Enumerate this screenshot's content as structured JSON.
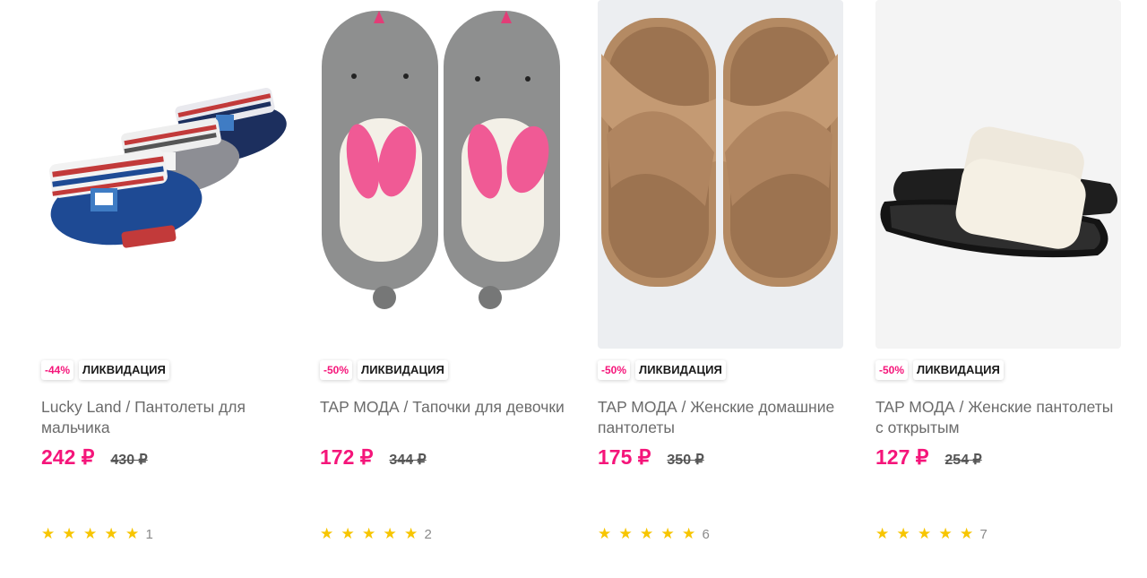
{
  "products": [
    {
      "discount": "-44%",
      "badge": "ЛИКВИДАЦИЯ",
      "title": "Lucky Land / Пантолеты для мальчика",
      "price": "242 ₽",
      "old_price": "430 ₽",
      "rating_stars": "★★★★★",
      "rating_value": 5,
      "reviews": "1"
    },
    {
      "discount": "-50%",
      "badge": "ЛИКВИДАЦИЯ",
      "title": "TAP МОДА / Тапочки для девочки",
      "price": "172 ₽",
      "old_price": "344 ₽",
      "rating_stars": "★★★★★",
      "rating_value": 5,
      "reviews": "2"
    },
    {
      "discount": "-50%",
      "badge": "ЛИКВИДАЦИЯ",
      "title": "TAP МОДА / Женские домашние пантолеты",
      "price": "175 ₽",
      "old_price": "350 ₽",
      "rating_stars": "★★★★★",
      "rating_value": 5,
      "reviews": "6"
    },
    {
      "discount": "-50%",
      "badge": "ЛИКВИДАЦИЯ",
      "title": "TAP МОДА / Женские пантолеты с открытым",
      "price": "127 ₽",
      "old_price": "254 ₽",
      "rating_stars": "★★★★★",
      "rating_value": 5,
      "reviews": "7"
    }
  ],
  "colors": {
    "accent": "#f5157a",
    "star": "#f7c500",
    "title_text": "#6b6b6b"
  }
}
